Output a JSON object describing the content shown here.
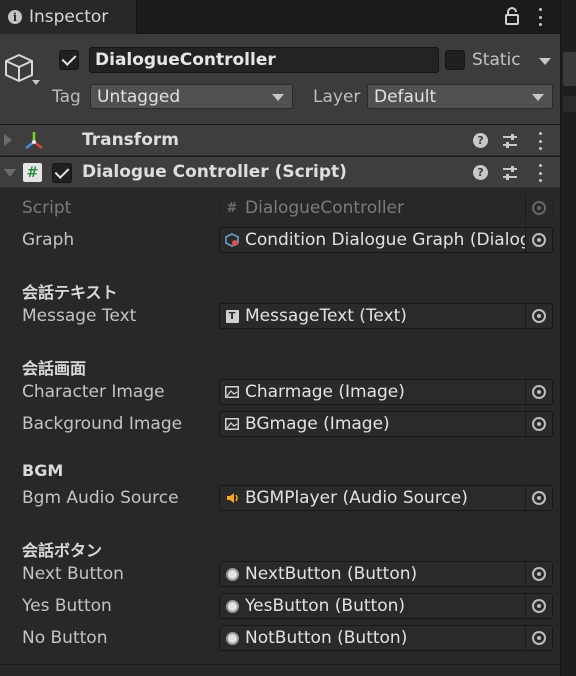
{
  "tab": {
    "title": "Inspector",
    "icon": "info-icon"
  },
  "gameobject": {
    "active": true,
    "name": "DialogueController",
    "static_label": "Static",
    "static_checked": false,
    "tag_label": "Tag",
    "tag_value": "Untagged",
    "layer_label": "Layer",
    "layer_value": "Default"
  },
  "components": [
    {
      "title": "Transform",
      "expanded": false,
      "icon": "transform-axes-icon"
    },
    {
      "title": "Dialogue Controller (Script)",
      "expanded": true,
      "enabled": true,
      "icon": "csharp-script-icon"
    }
  ],
  "fields": {
    "script": {
      "label": "Script",
      "value": "DialogueController",
      "icon": "csharp-script-icon"
    },
    "graph": {
      "label": "Graph",
      "value": "Condition Dialogue Graph (DialogueGraph)",
      "icon": "graph-asset-icon"
    },
    "section1": "会話テキスト",
    "message_text": {
      "label": "Message Text",
      "value": "MessageText (Text)",
      "icon": "text-component-icon"
    },
    "section2": "会話画面",
    "character_image": {
      "label": "Character Image",
      "value": "Charmage (Image)",
      "icon": "image-component-icon"
    },
    "background_image": {
      "label": "Background Image",
      "value": "BGmage (Image)",
      "icon": "image-component-icon"
    },
    "section3": "BGM",
    "bgm_audio_source": {
      "label": "Bgm Audio Source",
      "value": "BGMPlayer (Audio Source)",
      "icon": "audio-source-icon"
    },
    "section4": "会話ボタン",
    "next_button": {
      "label": "Next Button",
      "value": "NextButton (Button)",
      "icon": "button-component-icon"
    },
    "yes_button": {
      "label": "Yes Button",
      "value": "YesButton (Button)",
      "icon": "button-component-icon"
    },
    "no_button": {
      "label": "No Button",
      "value": "NotButton (Button)",
      "icon": "button-component-icon"
    }
  },
  "colors": {
    "panel": "#282828",
    "header": "#3c3c3c",
    "field": "#2a2a2a",
    "text": "#c4c4c4"
  }
}
